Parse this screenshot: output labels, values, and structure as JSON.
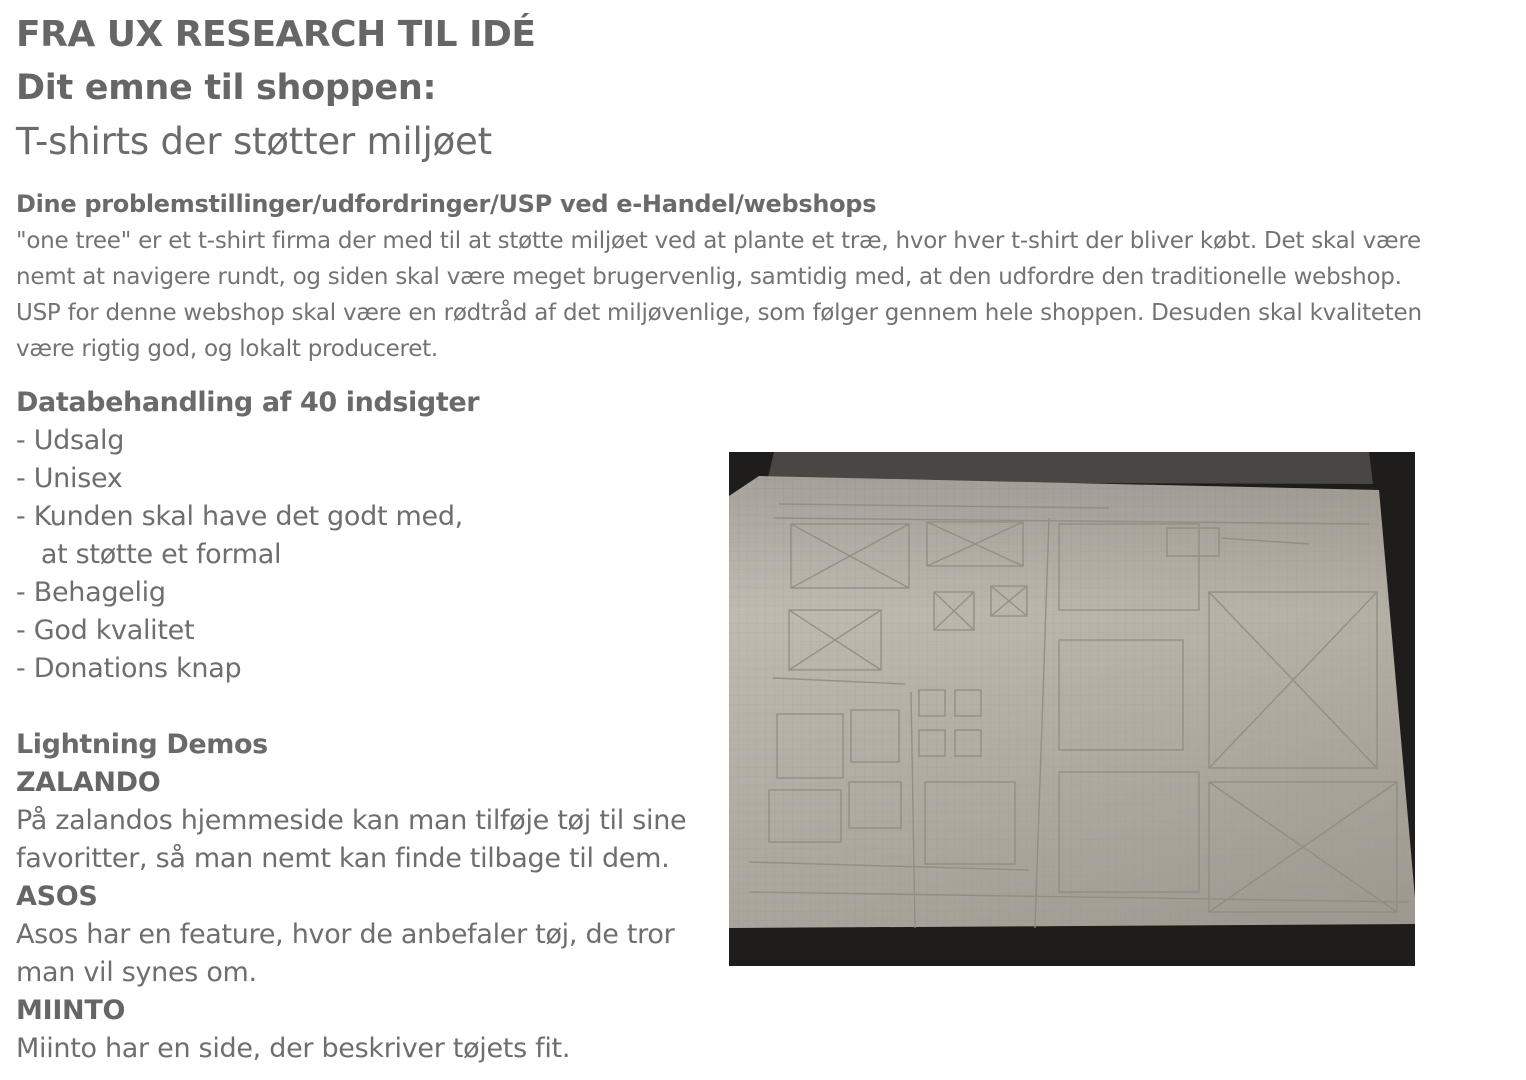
{
  "header": {
    "title": "FRA UX RESEARCH TIL IDÉ",
    "subtitle": "Dit emne til shoppen:",
    "topic": "T-shirts der støtter miljøet"
  },
  "problem": {
    "heading": "Dine problemstillinger/udfordringer/USP ved e-Handel/webshops",
    "lines": [
      "\"one tree\" er et t-shirt firma der med til at støtte miljøet ved at plante et træ, hvor hver t-shirt der bliver købt.  Det skal være",
      " nemt at navigere rundt, og siden skal være meget brugervenlig, samtidig med, at den udfordre den traditionelle webshop.",
      "USP for denne webshop skal være en rødtråd af det miljøvenlige, som følger gennem hele shoppen. Desuden skal kvaliteten",
      "være rigtig god, og lokalt produceret."
    ]
  },
  "data": {
    "heading": "Databehandling af 40 indsigter",
    "items": [
      "- Udsalg",
      "- Unisex",
      "- Kunden skal have det godt med,",
      "   at støtte et formal",
      "- Behagelig",
      "- God kvalitet",
      "- Donations knap"
    ]
  },
  "demos": {
    "heading": "Lightning Demos",
    "zalando": {
      "name": "ZALANDO",
      "lines": [
        "På zalandos hjemmeside kan man tilføje tøj til sine",
        "favoritter, så man nemt kan finde tilbage til dem."
      ]
    },
    "asos": {
      "name": "ASOS",
      "lines": [
        "Asos har en feature, hvor de anbefaler tøj, de tror",
        "man vil synes om."
      ]
    },
    "miinto": {
      "name": "MIINTO",
      "lines": [
        "Miinto har en side, der beskriver tøjets fit."
      ]
    }
  },
  "colors": {
    "text": "#6b6b6b",
    "paper": "#b9b4ab",
    "photo_background": "#1f1d1c"
  }
}
